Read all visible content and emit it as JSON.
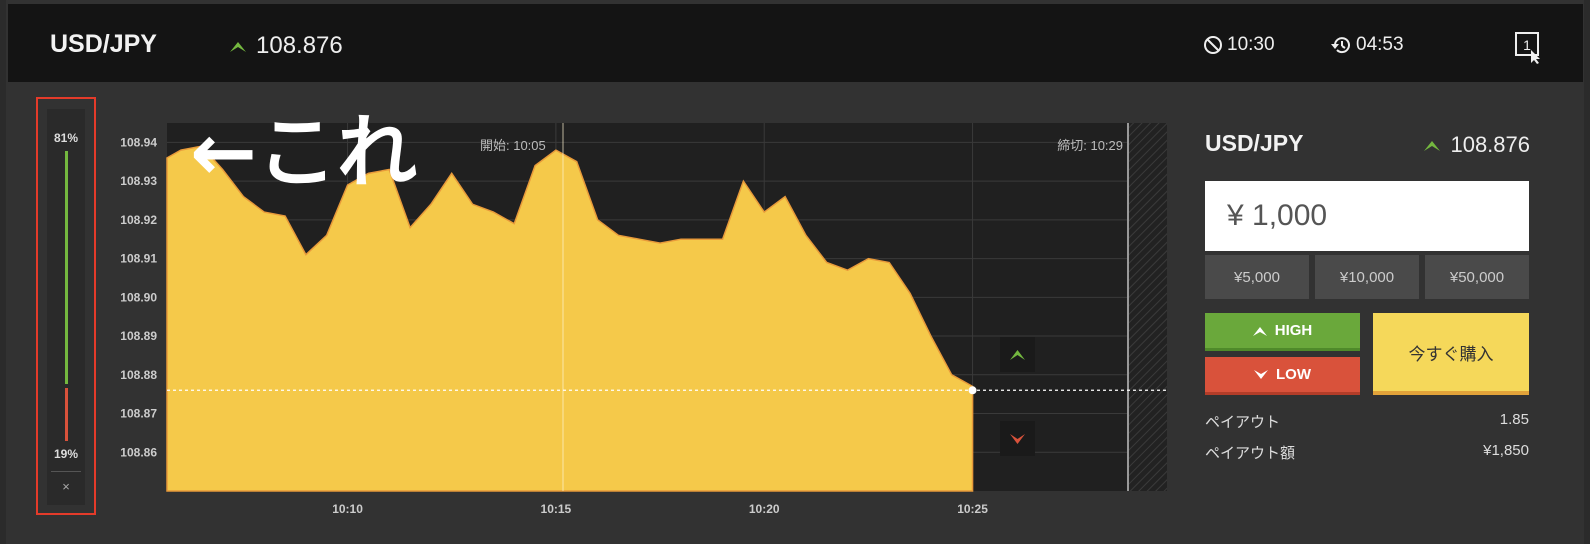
{
  "header": {
    "pair": "USD/JPY",
    "price": "108.876",
    "expiry_time": "10:30",
    "countdown": "04:53",
    "layout_label": "1"
  },
  "ratio": {
    "high_pct": "81%",
    "low_pct": "19%",
    "high_fraction": 0.81,
    "close": "×"
  },
  "chart": {
    "start_label": "開始: 10:05",
    "deadline_label": "締切: 10:29",
    "annotation": "←これ"
  },
  "chart_data": {
    "type": "area",
    "title": "",
    "xlabel": "",
    "ylabel": "",
    "x_ticks": [
      "10:10",
      "10:15",
      "10:20",
      "10:25"
    ],
    "y_ticks": [
      "108.94",
      "108.93",
      "108.92",
      "108.91",
      "108.90",
      "108.89",
      "108.88",
      "108.87",
      "108.86"
    ],
    "ylim": [
      108.85,
      108.945
    ],
    "xlim_minutes": [
      "10:05:40",
      "10:29:40"
    ],
    "current_price": 108.876,
    "series": [
      {
        "x": [
          "10:05:40",
          "10:06:00",
          "10:06:30",
          "10:07:00",
          "10:07:30",
          "10:08:00",
          "10:08:30",
          "10:09:00",
          "10:09:30",
          "10:10:00",
          "10:10:30",
          "10:11:00",
          "10:11:30",
          "10:12:00",
          "10:12:30",
          "10:13:00",
          "10:13:30",
          "10:14:00",
          "10:14:30",
          "10:15:00",
          "10:15:30",
          "10:16:00",
          "10:16:30",
          "10:17:00",
          "10:17:30",
          "10:18:00",
          "10:18:30",
          "10:19:00",
          "10:19:30",
          "10:20:00",
          "10:20:30",
          "10:21:00",
          "10:21:30",
          "10:22:00",
          "10:22:30",
          "10:23:00",
          "10:23:30",
          "10:24:00",
          "10:24:30",
          "10:25:00"
        ],
        "y": [
          108.936,
          108.938,
          108.939,
          108.933,
          108.926,
          108.922,
          108.921,
          108.911,
          108.916,
          108.929,
          108.932,
          108.933,
          108.918,
          108.924,
          108.932,
          108.924,
          108.922,
          108.919,
          108.934,
          108.938,
          108.935,
          108.92,
          108.916,
          108.915,
          108.914,
          108.915,
          108.915,
          108.915,
          108.93,
          108.922,
          108.926,
          108.916,
          108.909,
          108.907,
          108.91,
          108.909,
          108.901,
          108.89,
          108.88,
          108.877
        ]
      }
    ]
  },
  "panel": {
    "pair": "USD/JPY",
    "price": "108.876",
    "amount": "¥ 1,000",
    "presets": [
      "¥5,000",
      "¥10,000",
      "¥50,000"
    ],
    "high_label": "HIGH",
    "low_label": "LOW",
    "buy_label": "今すぐ購入",
    "payout_label": "ペイアウト",
    "payout_value": "1.85",
    "payout_amount_label": "ペイアウト額",
    "payout_amount_value": "¥1,850"
  },
  "colors": {
    "accent_green": "#74b83f",
    "accent_red": "#d9523b",
    "area_fill": "#f5c94a",
    "highlight_border": "#e43b2a"
  }
}
